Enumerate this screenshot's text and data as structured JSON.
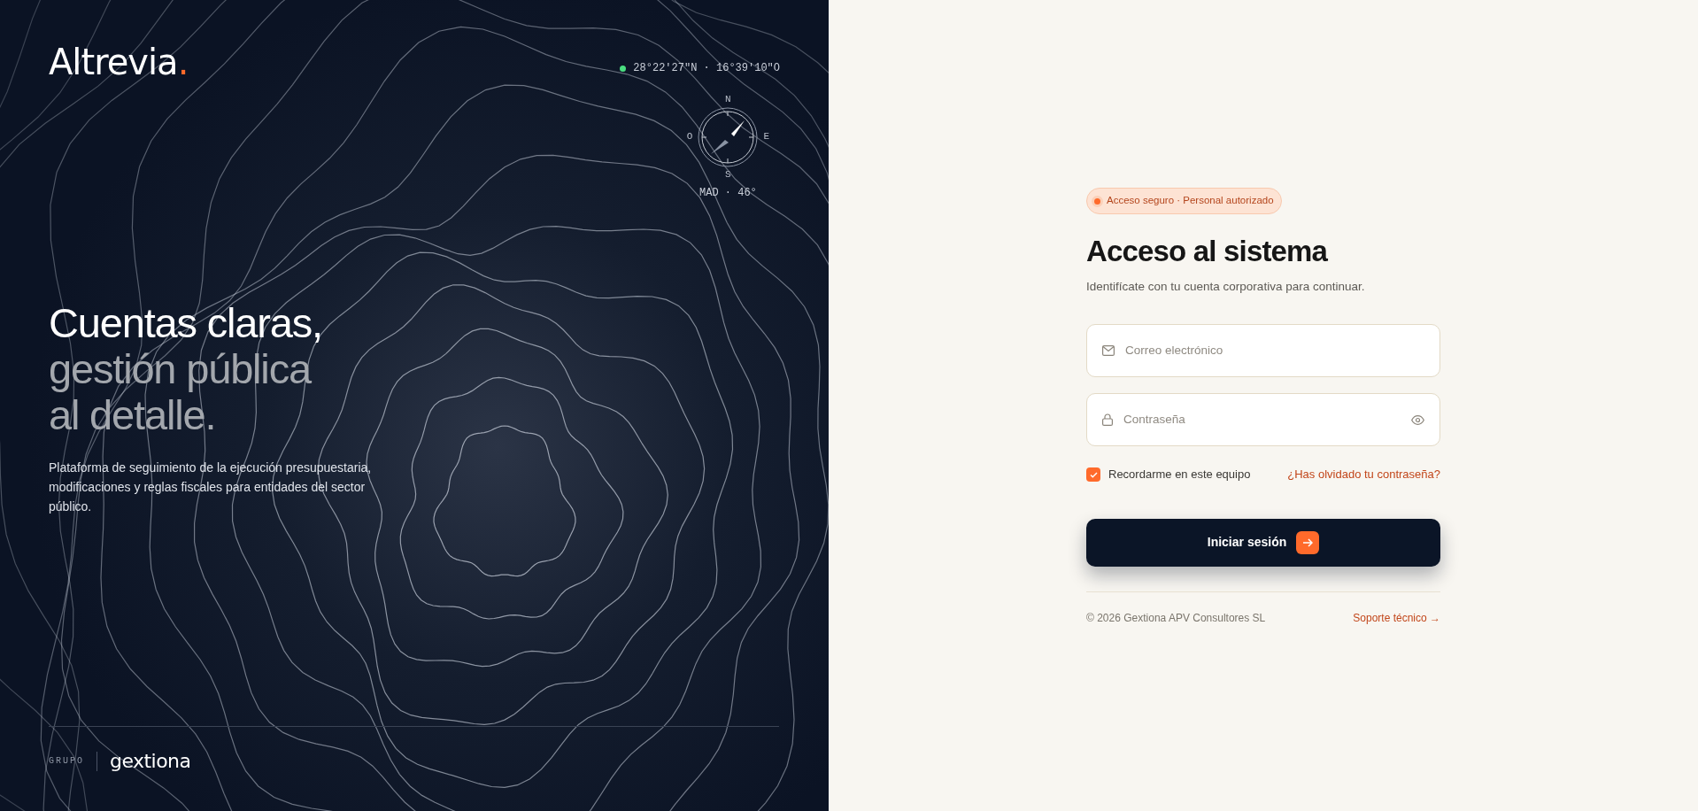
{
  "brand": {
    "name": "Altrevia",
    "dot": "."
  },
  "location": {
    "status_on": true,
    "coordinates": "28°22′27″N · 16°39′10″O"
  },
  "compass": {
    "north": "N",
    "west": "O",
    "east": "E",
    "south": "S",
    "reading": "MAD · 46°"
  },
  "headline": [
    {
      "text": "Cuentas claras,",
      "kind": "strong"
    },
    {
      "text": "gestión pública",
      "kind": "muted"
    },
    {
      "text": "al detalle.",
      "kind": "muted"
    }
  ],
  "description": "Plataforma de seguimiento de la ejecución presupuestaria, modificaciones y reglas fiscales para entidades del sector público.",
  "group": {
    "label": "GRUPO",
    "logo": "gextiona"
  },
  "badge": "Acceso seguro · Personal autorizado",
  "title": "Acceso al sistema",
  "subtitle": "Identifícate con tu cuenta corporativa para continuar.",
  "fields": [
    {
      "kind": "email",
      "placeholder": "Correo electrónico"
    },
    {
      "kind": "password",
      "placeholder": "Contraseña"
    }
  ],
  "remember": {
    "label": "Recordarme en este equipo",
    "checked": true
  },
  "forgot_link": "¿Has olvidado tu contraseña?",
  "submit": "Iniciar sesión",
  "footer": {
    "copyright": "© 2026 Gextiona APV Consultores SL",
    "support": "Soporte técnico →"
  }
}
